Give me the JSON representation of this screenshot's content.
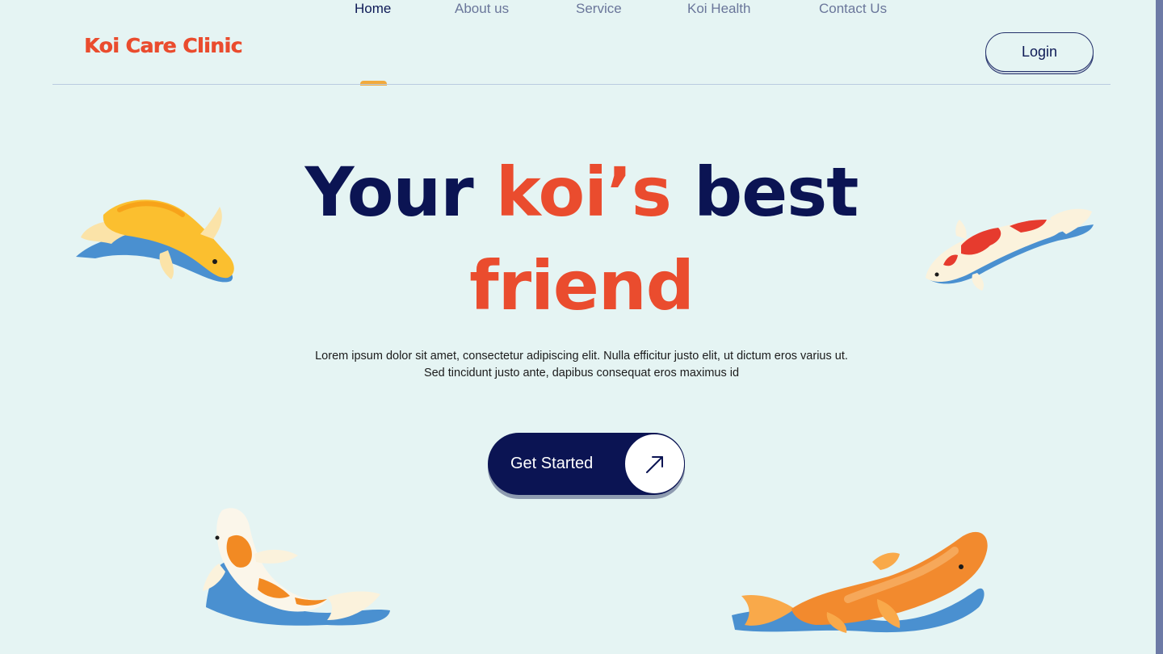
{
  "brand": {
    "logo_text": "Koi Care Clinic"
  },
  "nav": {
    "items": [
      {
        "label": "Home",
        "active": true
      },
      {
        "label": "About us",
        "active": false
      },
      {
        "label": "Service",
        "active": false
      },
      {
        "label": "Koi Health",
        "active": false
      },
      {
        "label": "Contact Us",
        "active": false
      }
    ],
    "login_label": "Login"
  },
  "hero": {
    "title_part1": "Your ",
    "title_accent": "koi’s",
    "title_part2": " best",
    "title_line2": "friend",
    "description_line1": "Lorem ipsum dolor sit amet, consectetur adipiscing elit. Nulla efficitur justo elit, ut dictum eros varius ut.",
    "description_line2": "Sed tincidunt justo ante, dapibus consequat eros maximus id",
    "cta_label": "Get Started",
    "cta_icon": "arrow-up-right-icon"
  },
  "colors": {
    "background": "#e5f4f3",
    "navy": "#0b1453",
    "accent_red": "#ea4c2e",
    "nav_muted": "#6a769a",
    "active_marker": "#f2a93b",
    "water_shadow": "#4a90d0"
  },
  "illustrations": [
    "yellow-koi-illustration",
    "red-white-koi-illustration",
    "orange-white-koi-illustration",
    "orange-koi-illustration"
  ]
}
